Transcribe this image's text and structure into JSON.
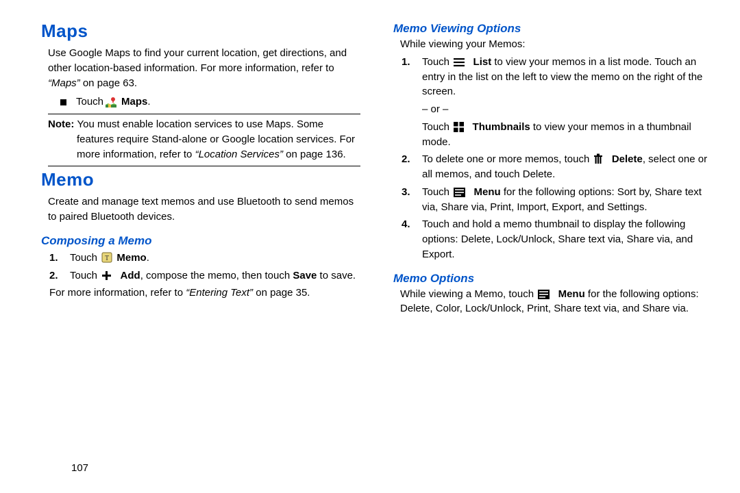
{
  "left": {
    "h_maps": "Maps",
    "maps_body": "Use Google Maps to find your current location, get directions, and other location-based information. For more information, refer to ",
    "maps_ref": "“Maps”",
    "maps_ref_tail": " on page 63.",
    "maps_touch_pre": "Touch ",
    "maps_touch_label": "Maps",
    "note_label": "Note: ",
    "note_body_1": "You must enable location services to use Maps. Some features require Stand-alone or Google location services. For more information, refer to ",
    "note_ref": "“Location Services”",
    "note_ref_tail": " on page 136.",
    "h_memo": "Memo",
    "memo_body": "Create and manage text memos and use Bluetooth to send memos to paired Bluetooth devices.",
    "h_compose": "Composing a Memo",
    "compose_1_pre": "Touch ",
    "compose_1_label": "Memo",
    "compose_2_pre": "Touch ",
    "compose_2_mid1": "Add",
    "compose_2_mid2": ", compose the memo, then touch ",
    "compose_2_save": "Save",
    "compose_2_tail": " to save.",
    "compose_footer_pre": "For more information, refer to ",
    "compose_footer_ref": "“Entering Text”",
    "compose_footer_tail": " on page 35."
  },
  "right": {
    "h_viewing": "Memo Viewing Options",
    "viewing_intro": "While viewing your Memos:",
    "v1_pre": "Touch ",
    "v1_list": "List",
    "v1_tail": " to view your memos in a list mode. Touch an entry in the list on the left to view the memo on the right of the screen.",
    "or": "– or –",
    "v1b_pre": "Touch ",
    "v1b_thumbs": "Thumbnails",
    "v1b_tail": " to view your memos in a thumbnail mode.",
    "v2_pre": "To delete one or more memos, touch ",
    "v2_delete": "Delete",
    "v2_tail": ", select one or all memos, and touch Delete.",
    "v3_pre": "Touch ",
    "v3_menu": "Menu",
    "v3_tail": " for the following options: Sort by, Share text via, Share via, Print, Import, Export, and Settings.",
    "v4": "Touch and hold a memo thumbnail to display the following options: Delete, Lock/Unlock, Share text via, Share via, and Export.",
    "h_options": "Memo Options",
    "opt_pre": "While viewing a Memo, touch ",
    "opt_menu": "Menu",
    "opt_tail": " for the following options: Delete, Color, Lock/Unlock, Print, Share text via, and Share via."
  },
  "page_number": "107"
}
